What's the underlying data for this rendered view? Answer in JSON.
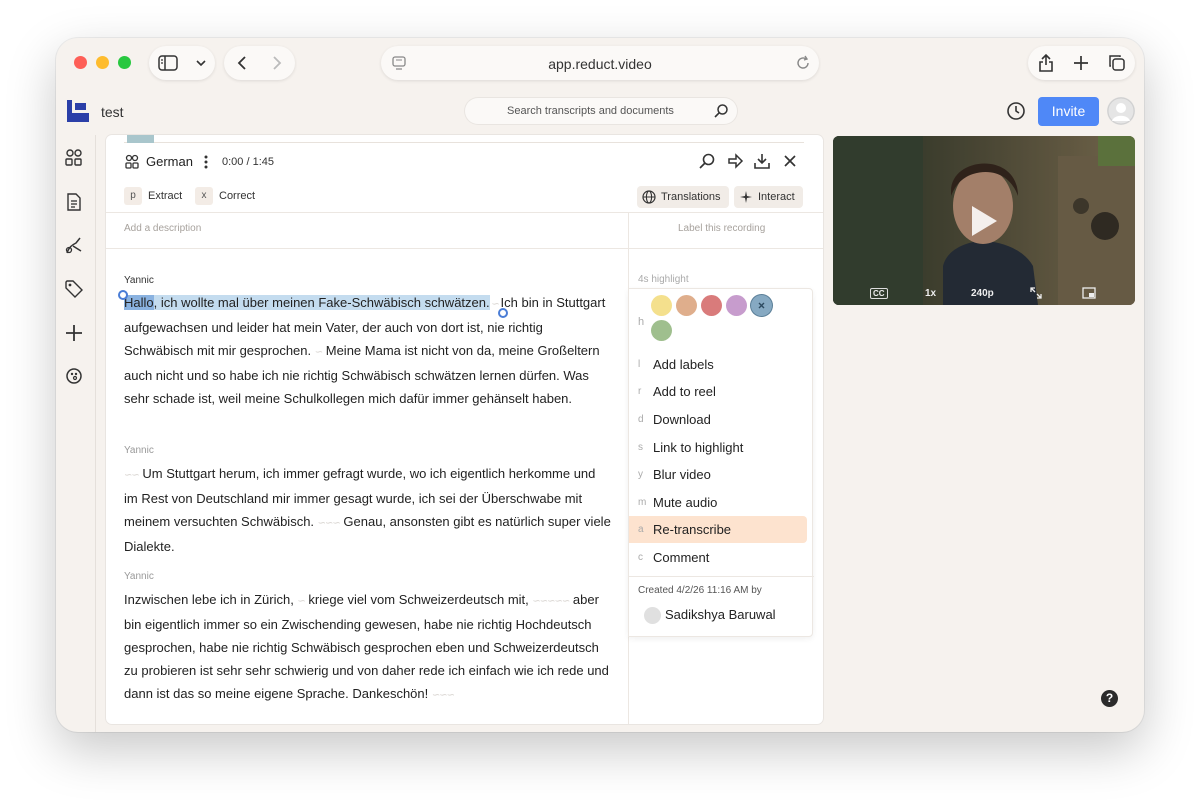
{
  "browser": {
    "url": "app.reduct.video"
  },
  "app": {
    "project_name": "test",
    "search_placeholder": "Search transcripts and documents",
    "invite_label": "Invite",
    "accent_color": "#4f88f7"
  },
  "panel": {
    "language": "German",
    "time": "0:00 / 1:45",
    "chips": [
      {
        "key": "p",
        "label": "Extract"
      },
      {
        "key": "x",
        "label": "Correct"
      }
    ],
    "translations_label": "Translations",
    "interact_label": "Interact",
    "description_placeholder": "Add a description",
    "label_recording_placeholder": "Label this recording"
  },
  "transcript": {
    "speaker": "Yannic",
    "p1_sel": "Hallo",
    "p1_hl": ", ich wollte mal über meinen Fake-Schwäbisch schwätzen.",
    "p1_a": " Ich bin in Stuttgart aufgewachsen und leider hat mein Vater, der auch von dort ist, nie richtig Schwäbisch mit mir gesprochen. ",
    "p1_b": " Meine Mama ist nicht von da, meine Großeltern auch nicht und so habe ich nie richtig Schwäbisch schwätzen lernen dürfen. Was sehr schade ist, weil meine Schulkollegen mich dafür immer gehänselt haben.",
    "p2_a": " Um Stuttgart herum, ich immer gefragt wurde, wo ich eigentlich herkomme und im Rest von Deutschland mir immer gesagt wurde, ich sei der Überschwabe mit meinem versuchten Schwäbisch. ",
    "p2_b": " Genau, ansonsten gibt es natürlich super viele Dialekte.",
    "p3_a": "Inzwischen lebe ich in Zürich, ",
    "p3_b": " kriege viel vom Schweizerdeutsch mit, ",
    "p3_c": " aber bin eigentlich immer so ein Zwischending gewesen, habe nie richtig Hochdeutsch gesprochen, habe nie richtig Schwäbisch gesprochen eben und Schweizerdeutsch zu probieren ist sehr sehr schwierig und von daher rede ich einfach wie ich rede und dann ist das so meine eigene Sprache. Dankeschön! "
  },
  "menu": {
    "highlight_label": "4s highlight",
    "color_key": "h",
    "colors": [
      "#f4e08d",
      "#dfae8c",
      "#d97b7b",
      "#c79ccd",
      "#86a9c2",
      "#9fbf8e"
    ],
    "items": [
      {
        "key": "l",
        "label": "Add labels"
      },
      {
        "key": "r",
        "label": "Add to reel"
      },
      {
        "key": "d",
        "label": "Download"
      },
      {
        "key": "s",
        "label": "Link to highlight"
      },
      {
        "key": "y",
        "label": "Blur video"
      },
      {
        "key": "m",
        "label": "Mute audio"
      },
      {
        "key": "a",
        "label": "Re-transcribe"
      },
      {
        "key": "c",
        "label": "Comment"
      }
    ],
    "created": "Created 4/2/26 11:16 AM by",
    "author": "Sadikshya Baruwal"
  },
  "video": {
    "cc": "CC",
    "speed": "1x",
    "quality": "240p"
  },
  "help": "?"
}
